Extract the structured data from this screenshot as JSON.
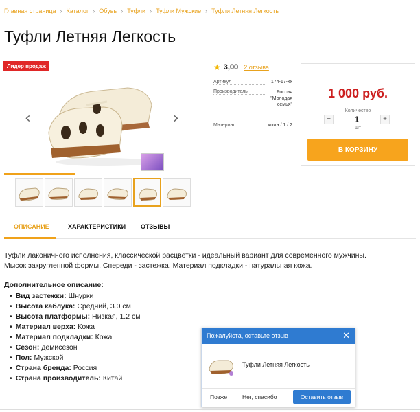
{
  "breadcrumb": [
    "Главная страница",
    "Каталог",
    "Обувь",
    "Туфли",
    "Туфли Мужские",
    "Туфли Летняя Легкость"
  ],
  "product": {
    "title": "Туфли Летняя Легкость",
    "badge": "Лидер продаж",
    "rating": "3,00",
    "reviews_link": "2 отзыва",
    "props": [
      {
        "k": "Артикул",
        "v": "174-17-хх"
      },
      {
        "k": "Производитель",
        "v": "Россия \"Молодая семья\""
      },
      {
        "k": "Материал",
        "v": "кожа / 1 / 2"
      }
    ]
  },
  "buy": {
    "price": "1 000 руб.",
    "qty_label": "Количество",
    "qty_minus": "−",
    "qty_plus": "+",
    "qty_value": "1",
    "qty_unit": "шт",
    "cart_button": "В КОРЗИНУ"
  },
  "tabs": [
    "ОПИСАНИЕ",
    "ХАРАКТЕРИСТИКИ",
    "ОТЗЫВЫ"
  ],
  "description": "Туфли лаконичного исполнения, классической расцветки - идеальный вариант для современного мужчины. Мысок закругленной формы. Спереди - застежка. Материал подкладки - натуральная кожа.",
  "more_title": "Дополнительное описание:",
  "features": [
    {
      "k": "Вид застежки:",
      "v": "Шнурки"
    },
    {
      "k": "Высота каблука:",
      "v": "Средний, 3.0 см"
    },
    {
      "k": "Высота платформы:",
      "v": "Низкая, 1.2 см"
    },
    {
      "k": "Материал верха:",
      "v": "Кожа"
    },
    {
      "k": "Материал подкладки:",
      "v": "Кожа"
    },
    {
      "k": "Сезон:",
      "v": "демисезон"
    },
    {
      "k": "Пол:",
      "v": "Мужской"
    },
    {
      "k": "Страна бренда:",
      "v": "Россия"
    },
    {
      "k": "Страна производитель:",
      "v": "Китай"
    }
  ],
  "popup": {
    "title": "Пожалуйста, оставьте отзыв",
    "product_name": "Туфли Летняя Легкость",
    "later": "Позже",
    "no_thanks": "Нет, спасибо",
    "leave_review": "Оставить отзыв"
  },
  "icons": {
    "star": "star-icon",
    "prev": "chevron-left-icon",
    "next": "chevron-right-icon",
    "close": "close-icon"
  },
  "colors": {
    "accent": "#f7a41d",
    "price": "#cc1f1f",
    "badge": "#e02727",
    "popup": "#2f7bd1"
  }
}
